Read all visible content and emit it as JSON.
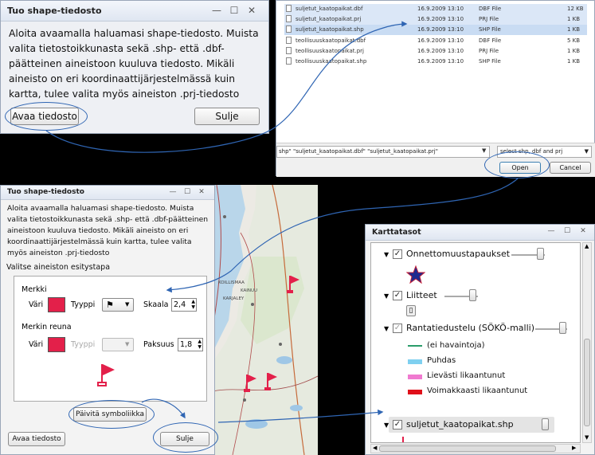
{
  "top_dialog": {
    "title": "Tuo shape-tiedosto",
    "text": "Aloita avaamalla haluamasi shape-tiedosto. Muista valita tietostoikkunasta sekä .shp- että .dbf-päätteinen aineistoon kuuluva tiedosto. Mikäli aineisto on eri koordinaattijärjestelmässä kuin kartta, tulee valita myös aineiston .prj-tiedosto",
    "open_button": "Avaa tiedosto",
    "close_button": "Sulje"
  },
  "file_dialog": {
    "files": [
      {
        "name": "suljetut_kaatopaikat.dbf",
        "date": "16.9.2009 13:10",
        "type": "DBF File",
        "size": "12 KB",
        "selected": true
      },
      {
        "name": "suljetut_kaatopaikat.prj",
        "date": "16.9.2009 13:10",
        "type": "PRJ File",
        "size": "1 KB",
        "selected": true
      },
      {
        "name": "suljetut_kaatopaikat.shp",
        "date": "16.9.2009 13:10",
        "type": "SHP File",
        "size": "1 KB",
        "selected": true
      },
      {
        "name": "teollisuuskaatopaikat.dbf",
        "date": "16.9.2009 13:10",
        "type": "DBF File",
        "size": "5 KB",
        "selected": false
      },
      {
        "name": "teollisuuskaatopaikat.prj",
        "date": "16.9.2009 13:10",
        "type": "PRJ File",
        "size": "1 KB",
        "selected": false
      },
      {
        "name": "teollisuuskaatopaikat.shp",
        "date": "16.9.2009 13:10",
        "type": "SHP File",
        "size": "1 KB",
        "selected": false
      }
    ],
    "filename_value": "shp\" \"suljetut_kaatopaikat.dbf\" \"suljetut_kaatopaikat.prj\"",
    "filter": "select shp, dbf and prj",
    "open_button": "Open",
    "cancel_button": "Cancel"
  },
  "mid_dialog": {
    "title": "Tuo shape-tiedosto",
    "text": "Aloita avaamalla haluamasi shape-tiedosto. Muista valita tietostoikkunasta sekä .shp- että .dbf-päätteinen aineistoon kuuluva tiedosto. Mikäli aineisto on eri koordinaattijärjestelmässä kuin kartta, tulee valita myös aineiston .prj-tiedosto",
    "style_label": "Valitse aineiston esitystapa",
    "marker_label": "Merkki",
    "color_label": "Väri",
    "type_label": "Tyyppi",
    "scale_label": "Skaala",
    "scale_value": "2,4",
    "border_label": "Merkin reuna",
    "border_color_label": "Väri",
    "border_type_label": "Tyyppi",
    "thickness_label": "Paksuus",
    "thickness_value": "1,8",
    "marker_color": "#e3204a",
    "update_button": "Päivitä symboliikka",
    "open_button": "Avaa tiedosto",
    "close_button": "Sulje"
  },
  "map": {
    "labels": [
      "KOILLISMAA",
      "KAINUU",
      "KARJALEY"
    ]
  },
  "layers": {
    "title": "Karttatasot",
    "items": [
      {
        "label": "Onnettomuustapaukset",
        "checked": true
      },
      {
        "label": "Liitteet",
        "checked": true
      },
      {
        "label": "Rantatiedustelu (SÖKÖ-malli)",
        "checked": true
      },
      {
        "label": "suljetut_kaatopaikat.shp",
        "checked": true
      }
    ],
    "legend": [
      {
        "label": "(ei havaintoja)",
        "color": "#2a9d6a"
      },
      {
        "label": "Puhdas",
        "color": "#7fd0f0"
      },
      {
        "label": "Lievästi likaantunut",
        "color": "#f07ad0"
      },
      {
        "label": "Voimakkaasti likaantunut",
        "color": "#e0101a"
      }
    ]
  }
}
